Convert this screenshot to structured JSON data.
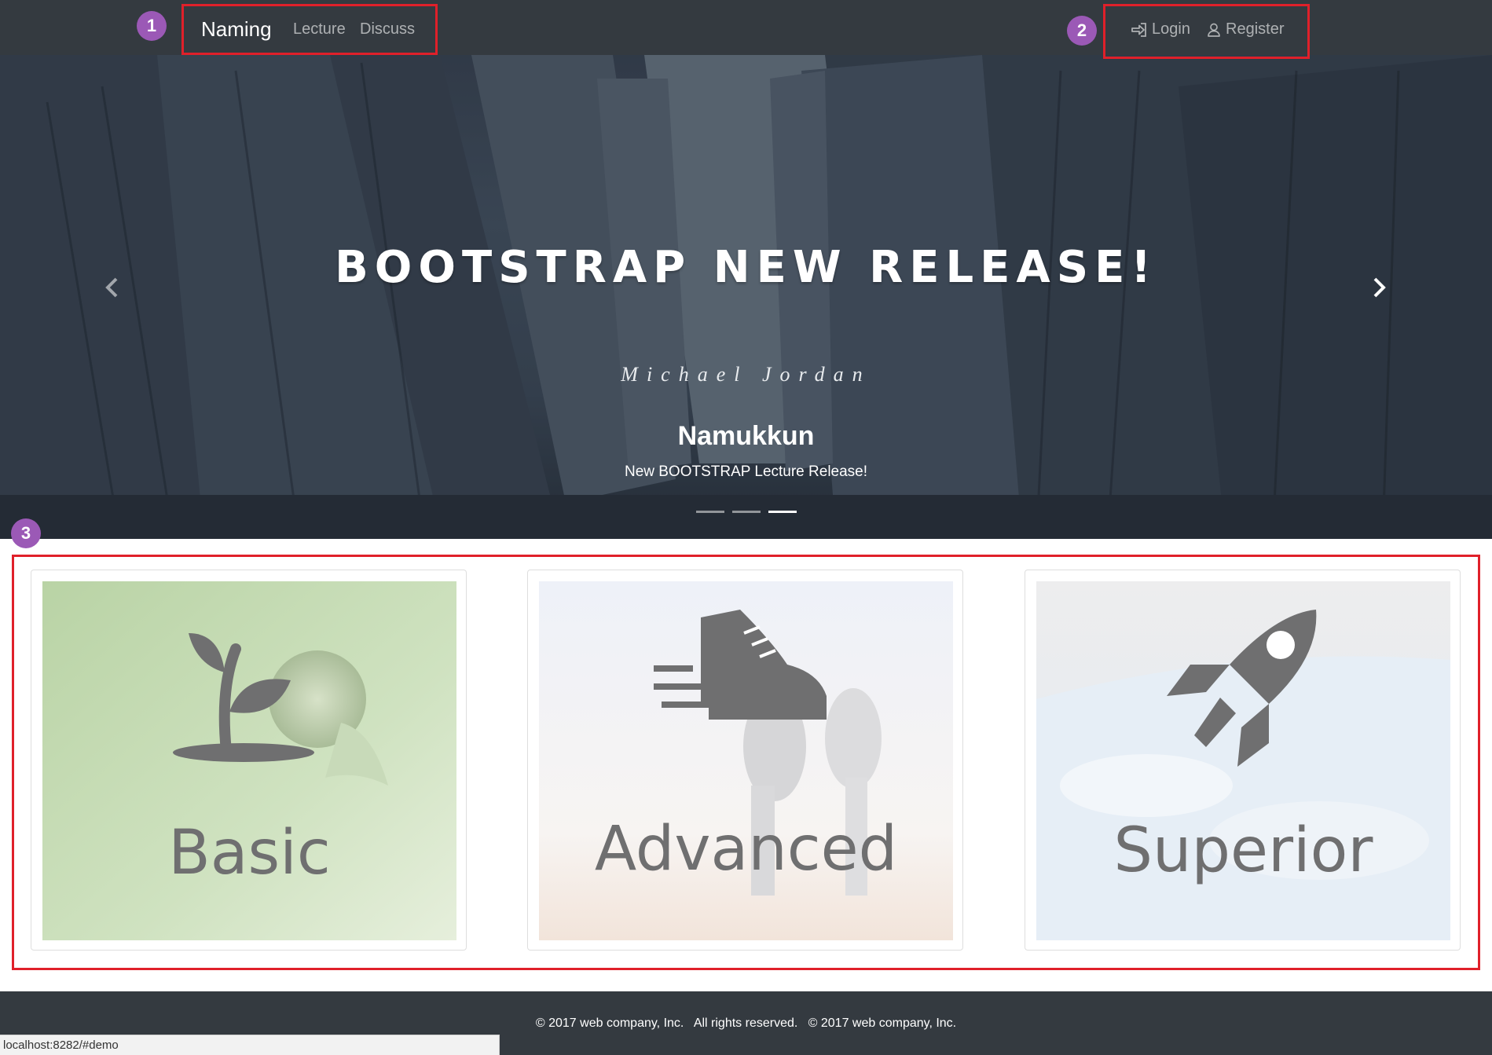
{
  "navbar": {
    "brand": "Naming",
    "links": [
      "Lecture",
      "Discuss"
    ],
    "login_label": "Login",
    "register_label": "Register"
  },
  "carousel": {
    "hero_title": "BOOTSTRAP NEW RELEASE!",
    "hero_subtitle": "Michael Jordan",
    "caption_title": "Namukkun",
    "caption_text": "New BOOTSTRAP Lecture Release!",
    "prev_icon": "chevron-left-icon",
    "next_icon": "chevron-right-icon",
    "slide_count": 3,
    "active_slide": 3
  },
  "cards": [
    {
      "label": "Basic",
      "icon": "sprout-icon"
    },
    {
      "label": "Advanced",
      "icon": "sneaker-icon"
    },
    {
      "label": "Superior",
      "icon": "rocket-icon"
    }
  ],
  "footer": {
    "text": "© 2017 web company, Inc.   All rights reserved.   © 2017 web company, Inc."
  },
  "statusbar": {
    "url": "localhost:8282/#demo"
  },
  "annotations": [
    "1",
    "2",
    "3"
  ],
  "colors": {
    "navbar_bg": "#343a40",
    "annotation_border": "#e0202a",
    "annotation_badge": "#9b59b6"
  }
}
